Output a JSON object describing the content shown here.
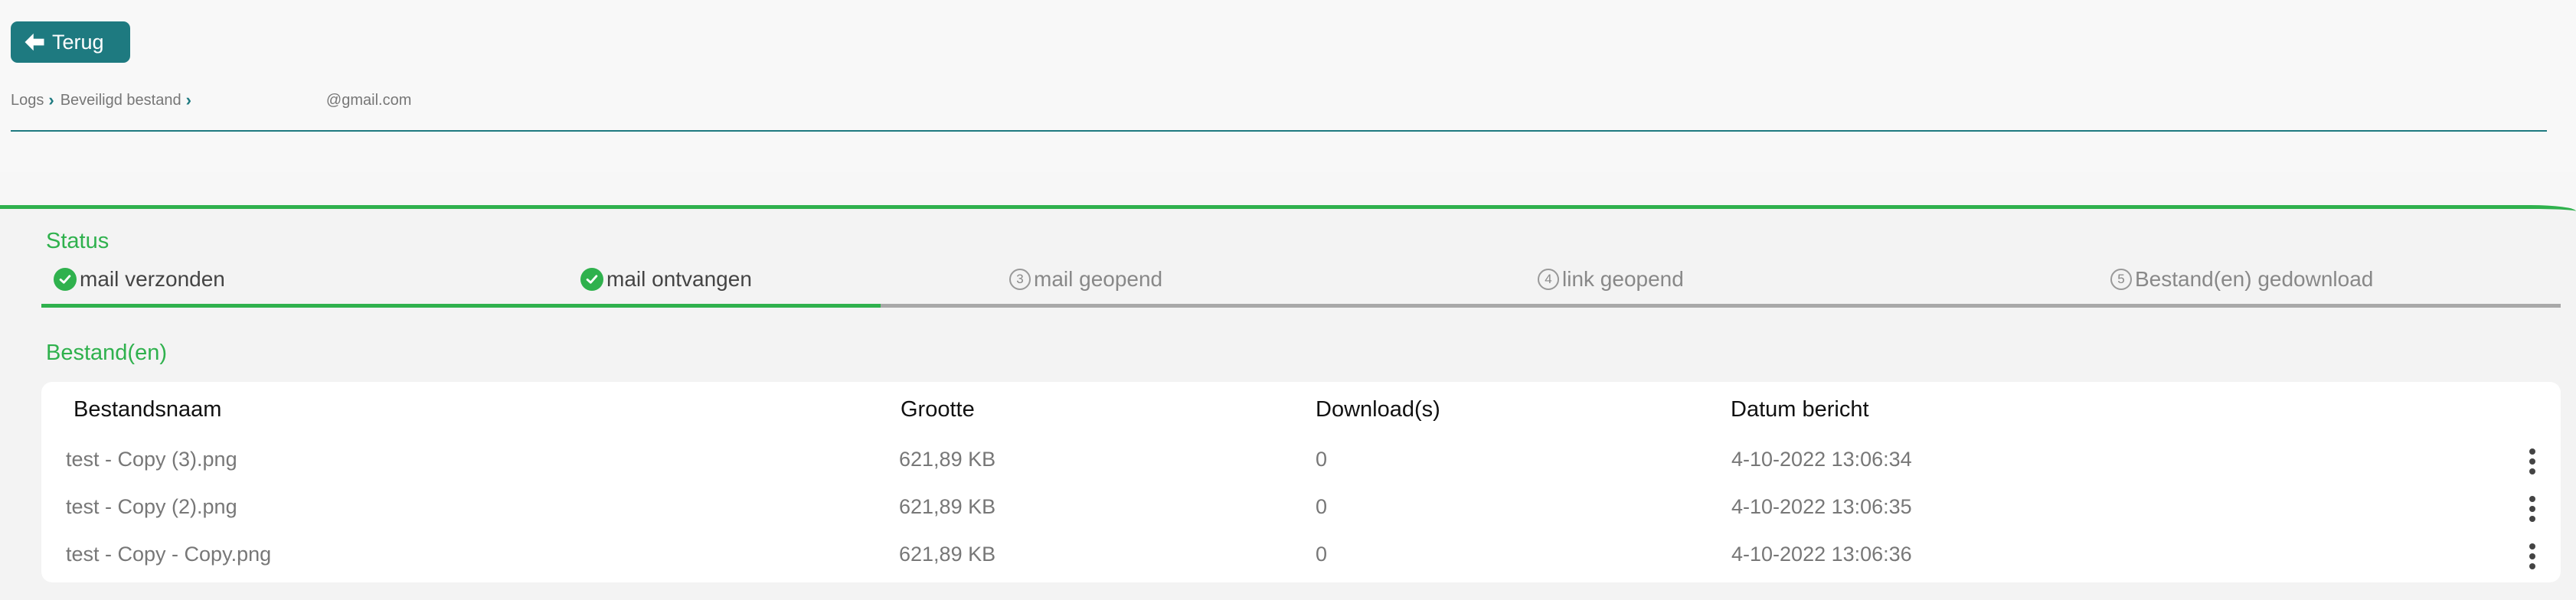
{
  "header": {
    "back_label": "Terug",
    "breadcrumb": [
      "Logs",
      "Beveiligd bestand"
    ],
    "email": "@gmail.com"
  },
  "status": {
    "title": "Status",
    "steps": [
      {
        "label": "mail verzonden",
        "done": true
      },
      {
        "label": "mail ontvangen",
        "done": true
      },
      {
        "label": "mail geopend",
        "num": "3",
        "done": false
      },
      {
        "label": "link geopend",
        "num": "4",
        "done": false
      },
      {
        "label": "Bestand(en) gedownload",
        "num": "5",
        "done": false
      }
    ],
    "progress_fraction": 0.333
  },
  "files": {
    "title": "Bestand(en)",
    "columns": [
      "Bestandsnaam",
      "Grootte",
      "Download(s)",
      "Datum bericht"
    ],
    "rows": [
      {
        "name": "test - Copy (3).png",
        "size": "621,89 KB",
        "downloads": "0",
        "date": "4-10-2022 13:06:34"
      },
      {
        "name": "test - Copy (2).png",
        "size": "621,89 KB",
        "downloads": "0",
        "date": "4-10-2022 13:06:35"
      },
      {
        "name": "test - Copy - Copy.png",
        "size": "621,89 KB",
        "downloads": "0",
        "date": "4-10-2022 13:06:36"
      }
    ]
  },
  "colors": {
    "accent": "#1e7a80",
    "success": "#2fb14d",
    "pending": "#a8a8a8"
  }
}
